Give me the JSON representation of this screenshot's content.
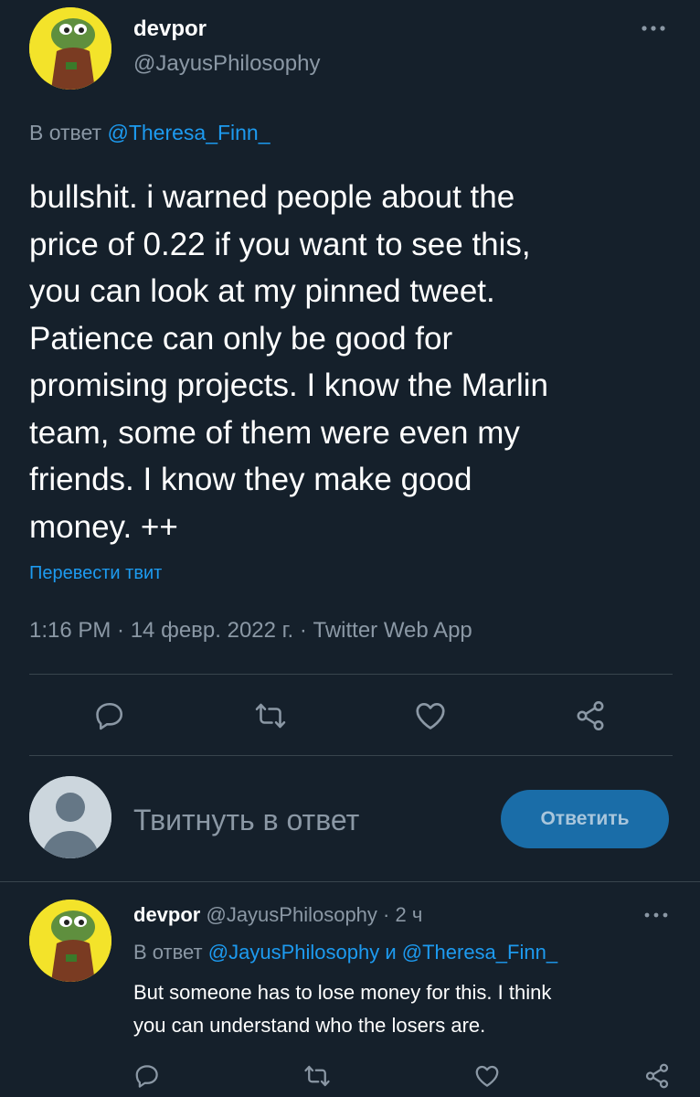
{
  "main_tweet": {
    "author_name": "devpor",
    "author_handle": "@JayusPhilosophy",
    "reply_prefix": "В ответ",
    "reply_to": "@Theresa_Finn_",
    "text_lines": [
      "bullshit. i warned people about the",
      "price of 0.22 if you want to see this,",
      "you can look at my pinned tweet.",
      "Patience can only be good for",
      "promising projects. I know the Marlin",
      "team, some of them were even my",
      "friends. I know they make good",
      "money. ++"
    ],
    "translate_label": "Перевести твит",
    "meta": "1:16 PM · 14 февр. 2022 г. · Twitter Web App",
    "more_icon": "more-dots-icon"
  },
  "actions": {
    "icons": [
      "reply-icon",
      "retweet-icon",
      "like-icon",
      "share-icon"
    ]
  },
  "composer": {
    "placeholder": "Твитнуть в ответ",
    "button_label": "Ответить"
  },
  "reply_tweet": {
    "author_name": "devpor",
    "author_handle": "@JayusPhilosophy",
    "time": "· 2 ч",
    "reply_prefix": "В ответ",
    "reply_to_1": "@JayusPhilosophy",
    "conj": "и",
    "reply_to_2": "@Theresa_Finn_",
    "text_lines": [
      "But someone has to lose money for this. I think",
      "you can understand who the losers are."
    ]
  },
  "colors": {
    "background": "#15202b",
    "accent": "#1d9bf0",
    "muted": "#8b98a5",
    "divider": "#38444d"
  }
}
